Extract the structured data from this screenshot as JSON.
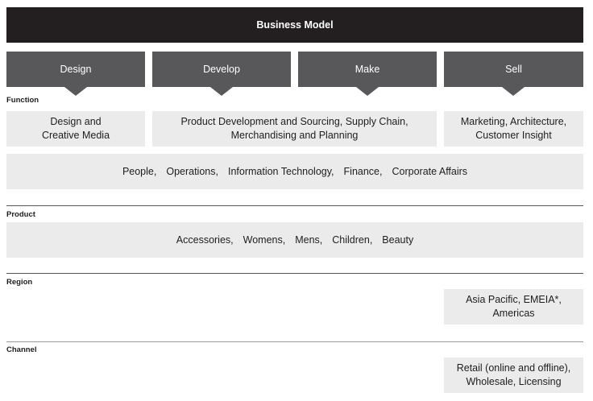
{
  "title": "Business Model",
  "stages": [
    "Design",
    "Develop",
    "Make",
    "Sell"
  ],
  "sections": {
    "function": "Function",
    "product": "Product",
    "region": "Region",
    "channel": "Channel"
  },
  "function_cells": {
    "design": "Design and\nCreative Media",
    "develop": "Product Development and Sourcing, Supply Chain,\nMerchandising and Planning",
    "sell": "Marketing, Architecture,\nCustomer Insight"
  },
  "shared_functions": [
    "People,",
    "Operations,",
    "Information Technology,",
    "Finance,",
    "Corporate Affairs"
  ],
  "products": [
    "Accessories,",
    "Womens,",
    "Mens,",
    "Children,",
    "Beauty"
  ],
  "region_cell": "Asia Pacific, EMEIA*,\nAmericas",
  "channel_cell": "Retail (online and offline),\nWholesale, Licensing"
}
